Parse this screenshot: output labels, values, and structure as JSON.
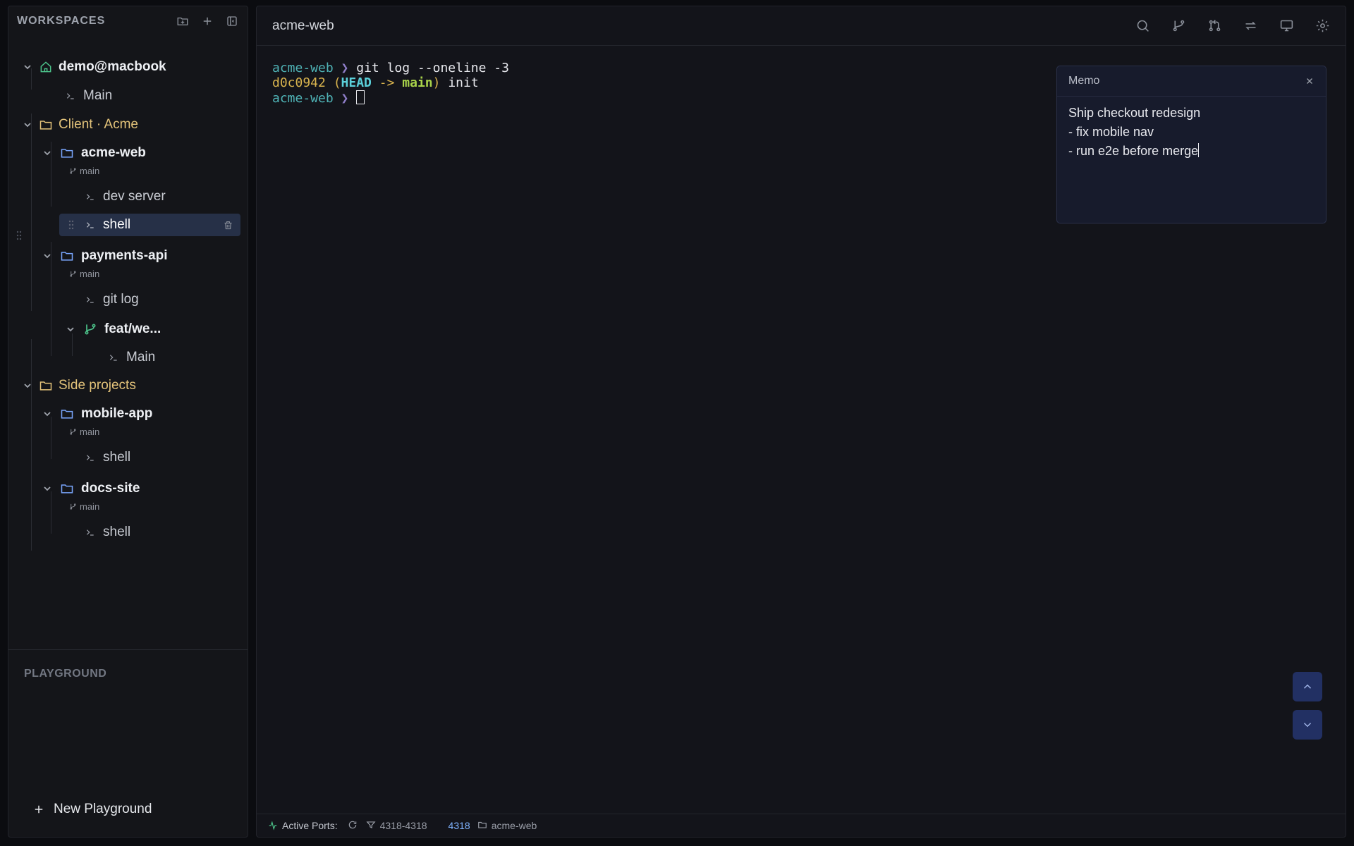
{
  "sidebar": {
    "title": "WORKSPACES",
    "tree": {
      "host": "demo@macbook",
      "host_terminal": "Main",
      "group1": "Client · Acme",
      "acme_web": {
        "name": "acme-web",
        "branch": "main",
        "term1": "dev server",
        "term2": "shell"
      },
      "payments_api": {
        "name": "payments-api",
        "branch": "main",
        "term1": "git log",
        "worktree": "feat/we...",
        "worktree_term": "Main"
      },
      "group2": "Side projects",
      "mobile_app": {
        "name": "mobile-app",
        "branch": "main",
        "term1": "shell"
      },
      "docs_site": {
        "name": "docs-site",
        "branch": "main",
        "term1": "shell"
      }
    },
    "playground_title": "PLAYGROUND",
    "new_playground": "New Playground"
  },
  "main": {
    "title": "acme-web",
    "terminal": {
      "prompt": "acme-web",
      "arrow": "❯",
      "command": "git log --oneline -3",
      "hash": "d0c0942",
      "head": "HEAD",
      "ptr": "->",
      "branch": "main",
      "message": "init"
    },
    "memo": {
      "title": "Memo",
      "line1": "Ship checkout redesign",
      "line2": "- fix mobile nav",
      "line3": "- run e2e before merge"
    },
    "status": {
      "active_ports": "Active Ports:",
      "range": "4318-4318",
      "port": "4318",
      "project": "acme-web"
    }
  },
  "colors": {
    "accent": "#4fb3b6",
    "group": "#e3c37a",
    "folder": "#7aa7ff",
    "branch": "#4cc38a"
  }
}
